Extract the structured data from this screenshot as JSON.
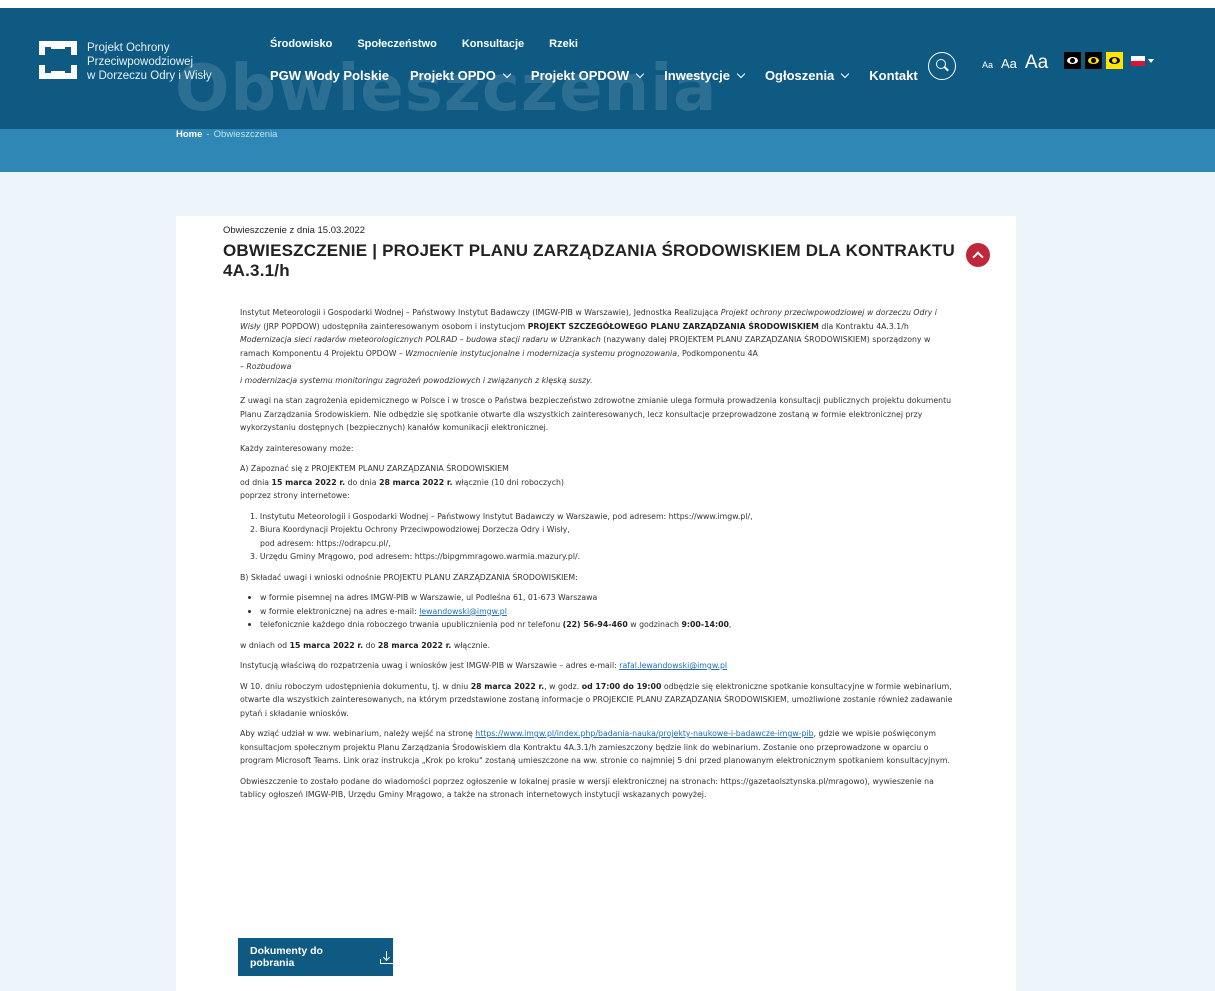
{
  "header": {
    "logo_text": [
      "Projekt Ochrony",
      "Przeciwpowodziowej",
      "w Dorzeczu Odry i Wisły"
    ],
    "bg_title": "Obwieszczenia",
    "nav_top": [
      "Środowisko",
      "Społeczeństwo",
      "Konsultacje",
      "Rzeki"
    ],
    "nav_main": [
      {
        "label": "PGW Wody Polskie",
        "dropdown": false
      },
      {
        "label": "Projekt OPDO",
        "dropdown": true
      },
      {
        "label": "Projekt OPDOW",
        "dropdown": true
      },
      {
        "label": "Inwestycje",
        "dropdown": true
      },
      {
        "label": "Ogłoszenia",
        "dropdown": true
      },
      {
        "label": "Kontakt",
        "dropdown": false
      }
    ],
    "font_sizes": [
      "Aa",
      "Aa",
      "Aa"
    ],
    "colors": {
      "primary": "#0e5a82",
      "breadcrumb_bg": "#2f87b5",
      "accent_red": "#c0283a",
      "yellow": "#ffe500"
    }
  },
  "breadcrumb": {
    "home": "Home",
    "separator": "-",
    "current": "Obwieszczenia"
  },
  "article": {
    "date": "Obwieszczenie z dnia 15.03.2022",
    "title": "OBWIESZCZENIE | PROJEKT PLANU ZARZĄDZANIA ŚRODOWISKIEM DLA KONTRAKTU 4A.3.1/h",
    "p1": "Instytut Meteorologii i Gospodarki Wodnej – Państwowy Instytut Badawczy (IMGW-PIB w Warszawie), Jednostka Realizująca",
    "p1_i1": "Projekt ochrony przeciwpowodziowej w dorzeczu Odry i Wisły",
    "p1_t2": "(JRP POPDOW) udostępniła zainteresowanym osobom i instytucjom",
    "p1_b1": "PROJEKT SZCZEGÓŁOWEGO PLANU ZARZĄDZANIA ŚRODOWISKIEM",
    "p1_t3": "dla Kontraktu 4A.3.1/h",
    "p1_i2": "Modernizacja sieci radarów meteorologicznych POLRAD – budowa stacji radaru w Użrankach",
    "p1_t4": "(nazywany dalej PROJEKTEM PLANU ZARZĄDZANIA ŚRODOWISKIEM) sporządzony w ramach Komponentu 4 Projektu OPDOW –",
    "p1_i3": "Wzmocnienie instytucjonalne i modernizacja systemu prognozowania",
    "p1_t5": ", Podkomponentu 4A",
    "p1_i4a": "– Rozbudowa",
    "p1_i4b": "i modernizacja systemu monitoringu zagrożeń powodziowych i związanych z klęską suszy.",
    "p2": "Z uwagi na stan zagrożenia epidemicznego w Polsce i w trosce o Państwa bezpieczeństwo zdrowotne zmianie ulega formuła prowadzenia konsultacji publicznych projektu dokumentu Planu Zarządzania Środowiskiem. Nie odbędzie się spotkanie otwarte dla wszystkich zainteresowanych, lecz konsultacje przeprowadzone zostaną w formie elektronicznej przy wykorzystaniu dostępnych (bezpiecznych) kanałów komunikacji elektronicznej.",
    "p3": "Każdy zainteresowany może:",
    "a_line": "A) Zapoznać się z PROJEKTEM PLANU ZARZĄDZANIA ŚRODOWISKIEM",
    "a_from": "od dnia",
    "a_d1": "15 marca 2022 r.",
    "a_to": "do dnia",
    "a_d2": "28 marca 2022 r.",
    "a_rest": "włącznie (10 dni roboczych)",
    "a_via": "poprzez strony internetowe:",
    "ol": [
      "1. Instytutu Meteorologii i Gospodarki Wodnej – Państwowy Instytut Badawczy w Warszawie, pod adresem: https://www.imgw.pl/,",
      "2. Biura Koordynacji Projektu Ochrony Przeciwpowodziowej Dorzecza Odry i Wisły,",
      "pod adresem: https://odrapcu.pl/,",
      "3. Urzędu Gminy Mrągowo, pod adresem: https://bipgmmragowo.warmia.mazury.pl/."
    ],
    "b_line": "B) Składać uwagi i wnioski odnośnie PROJEKTU PLANU ZARZĄDZANIA ŚRODOWISKIEM:",
    "ul1": "w formie pisemnej na adres IMGW-PIB w Warszawie, ul Podleśna 61, 01-673 Warszawa",
    "ul2": "w formie elektronicznej na adres e-mail:",
    "ul2_link": "lewandowski@imgw.pl",
    "ul3a": "telefonicznie każdego dnia roboczego trwania upublicznienia pod nr telefonu",
    "ul3_phone": "(22) 56-94-460",
    "ul3b": "w godzinach",
    "ul3_hours": "9:00-14:00",
    "ul3c": ",",
    "p_days_a": "w dniach od",
    "p_days_d1": "15 marca 2022 r.",
    "p_days_b": "do",
    "p_days_d2": "28 marca 2022 r.",
    "p_days_c": "włącznie.",
    "p_inst": "Instytucją właściwą do rozpatrzenia uwag i wniosków jest IMGW-PIB w Warszawie – adres e-mail:",
    "p_inst_link": "rafal.lewandowski@imgw.pl",
    "p_web_a": "W 10. dniu roboczym udostępnienia dokumentu, tj. w dniu",
    "p_web_d": "28 marca 2022 r.",
    "p_web_b": ", w godz.",
    "p_web_h": "od 17:00 do 19:00",
    "p_web_c": "odbędzie się elektroniczne spotkanie konsultacyjne w formie webinarium, otwarte dla wszystkich zainteresowanych, na którym przedstawione zostaną informacje o PROJEKCIE PLANU ZARZĄDZANIA ŚRODOWISKIEM, umożliwione zostanie również zadawanie pytań i składanie wniosków.",
    "p_join_a": "Aby wziąć udział w ww. webinarium, należy wejść na stronę",
    "p_join_link": "https://www.imgw.pl/index.php/badania-nauka/projekty-naukowe-i-badawcze-imgw-pib",
    "p_join_b": ", gdzie we wpisie poświęconym konsultacjom społecznym projektu Planu Zarządzania Środowiskiem dla Kontraktu 4A.3.1/h zamieszczony będzie link do webinarium. Zostanie ono przeprowadzone w oparciu o program Microsoft Teams. Link oraz instrukcja „Krok po kroku\" zostaną umieszczone na ww. stronie co najmniej 5 dni przed planowanym elektronicznym spotkaniem konsultacyjnym.",
    "p_last": "Obwieszczenie to zostało podane do wiadomości poprzez ogłoszenie w lokalnej prasie w wersji elektronicznej na stronach: https://gazetaolsztynska.pl/mragowo), wywieszenie na tablicy ogłoszeń IMGW-PIB, Urzędu Gminy Mrągowo, a także na stronach internetowych instytucji wskazanych powyżej.",
    "download_label": "Dokumenty do pobrania"
  }
}
